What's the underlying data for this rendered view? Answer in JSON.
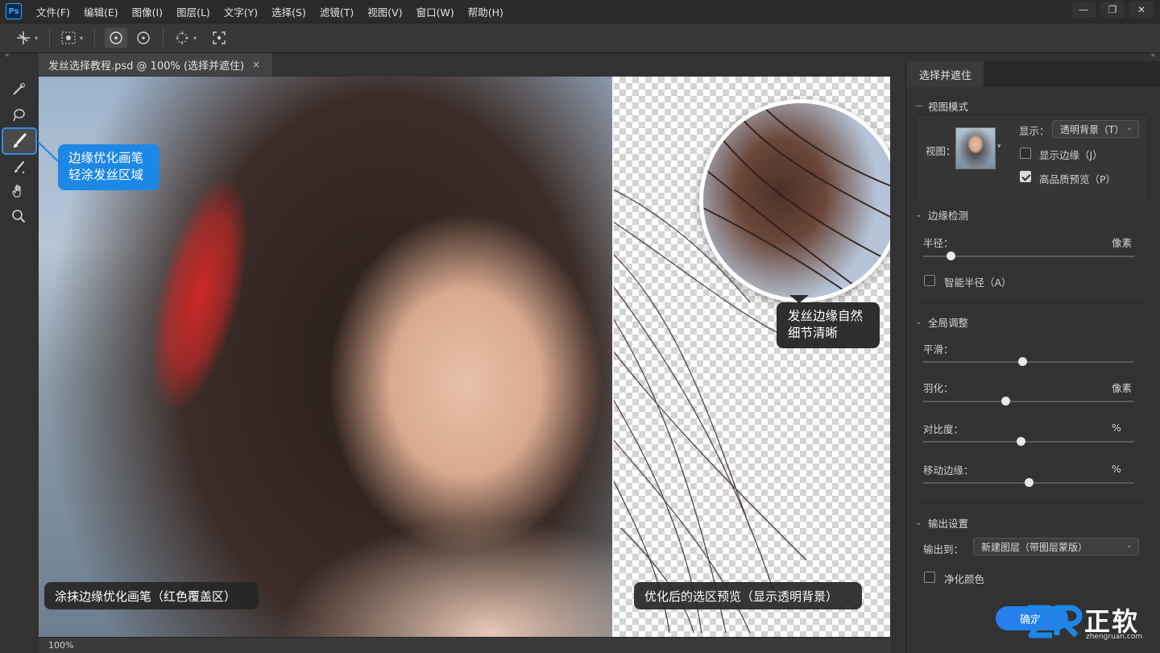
{
  "app": {
    "logo": "Ps"
  },
  "menu": [
    "文件(F)",
    "编辑(E)",
    "图像(I)",
    "图层(L)",
    "文字(Y)",
    "选择(S)",
    "滤镜(T)",
    "视图(V)",
    "窗口(W)",
    "帮助(H)"
  ],
  "window_controls": {
    "minimize": "—",
    "restore": "❐",
    "close": "✕"
  },
  "document": {
    "tab_title": "发丝选择教程.psd @ 100% (选择并遮住)",
    "tab_close": "×",
    "zoom_status": "100%"
  },
  "callouts": {
    "brush_tip": "边缘优化画笔\n轻涂发丝区域",
    "hair_tip": "发丝边缘自然\n细节清晰"
  },
  "captions": {
    "left": "涂抹边缘优化画笔（红色覆盖区）",
    "right": "优化后的选区预览（显示透明背景）"
  },
  "panel": {
    "tab": "选择并遮住",
    "view_mode": {
      "title": "视图模式",
      "view_label": "视图：",
      "display_label": "显示：",
      "display_value": "透明背景（T）",
      "show_edge": {
        "label": "显示边缘（J）",
        "checked": false
      },
      "hq_preview": {
        "label": "高品质预览（P）",
        "checked": true
      }
    },
    "edge_detection": {
      "title": "边缘检测",
      "radius_label": "半径：",
      "radius_unit": "像素",
      "radius_level": 0.13,
      "smart_radius": {
        "label": "智能半径（A）",
        "checked": false
      }
    },
    "global": {
      "title": "全局调整",
      "smooth": {
        "label": "平滑：",
        "unit": "",
        "level": 0.47
      },
      "feather": {
        "label": "羽化：",
        "unit": "像素",
        "level": 0.39
      },
      "contrast": {
        "label": "对比度：",
        "unit": "%",
        "level": 0.46
      },
      "shift_edge": {
        "label": "移动边缘：",
        "unit": "%",
        "level": 0.5
      }
    },
    "output": {
      "title": "输出设置",
      "output_to_label": "输出到：",
      "output_to_value": "新建图层（带图层蒙版）",
      "decontaminate": {
        "label": "净化颜色",
        "checked": false
      }
    },
    "ok_button": "确定"
  },
  "watermark": {
    "brand": "正软",
    "site": "zhengruan.com"
  },
  "colors": {
    "accent": "#2680eb",
    "callout_blue": "#1d87e5",
    "brush_overlay": "#ff2828"
  }
}
